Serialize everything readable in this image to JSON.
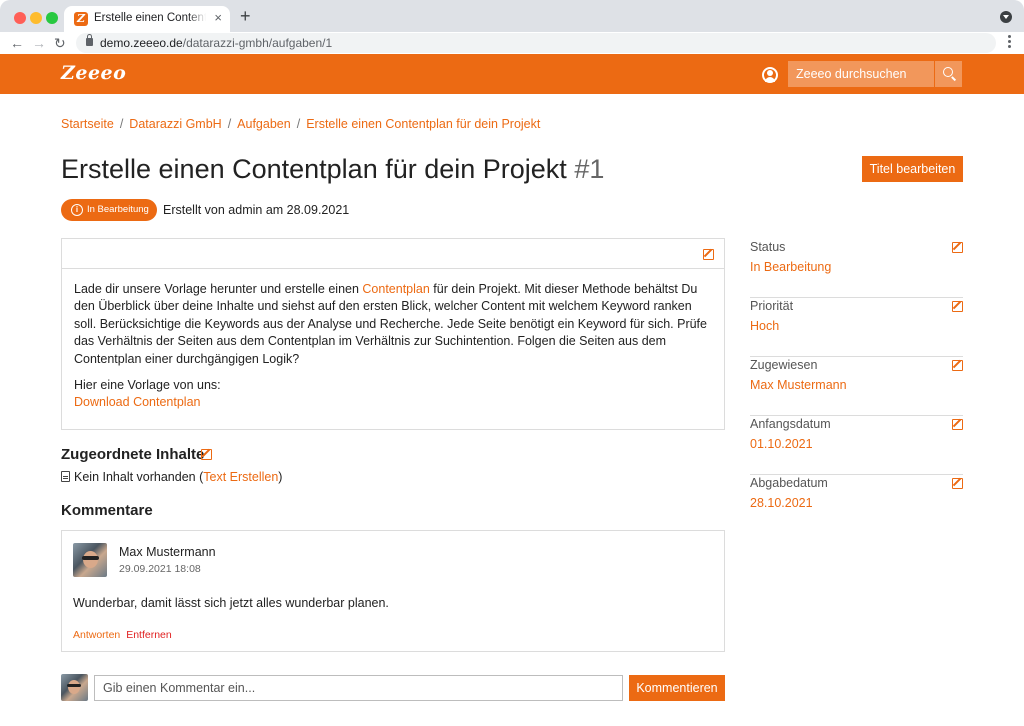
{
  "browser": {
    "tab_title": "Erstelle einen Contentplan für dein Projekt",
    "tab_close": "×",
    "new_tab": "+",
    "url_host": "demo.zeeeo.de",
    "url_path": "/datarazzi-gmbh/aufgaben/1",
    "nav_back": "←",
    "nav_forward": "→",
    "nav_reload": "↻",
    "favicon": "Z"
  },
  "header": {
    "logo": "Zeeeo",
    "search_placeholder": "Zeeeo durchsuchen"
  },
  "breadcrumb": {
    "items": [
      "Startseite",
      "Datarazzi GmbH",
      "Aufgaben",
      "Erstelle einen Contentplan für dein Projekt"
    ],
    "separator": "/"
  },
  "task": {
    "title": "Erstelle einen Contentplan für dein Projekt",
    "number": "#1",
    "edit_title_label": "Titel bearbeiten",
    "status_badge": "In Bearbeitung",
    "status_badge_icon": "i",
    "created_text": "Erstellt von admin am 28.09.2021"
  },
  "description": {
    "text_before": "Lade dir unsere Vorlage herunter und erstelle einen ",
    "link": "Contentplan",
    "text_after": " für dein Projekt. Mit dieser Methode behältst Du den Überblick über deine Inhalte und siehst auf den ersten Blick, welcher Content mit welchem Keyword ranken soll. Berücksichtige die Keywords aus der Analyse und Recherche. Jede Seite benötigt ein Keyword für sich. Prüfe das Verhältnis der Seiten aus dem Contentplan im Verhältnis zur Suchintention. Folgen die Seiten aus dem Contentplan einer durchgängigen Logik?",
    "template_intro": "Hier eine Vorlage von uns:",
    "download_link": "Download Contentplan"
  },
  "assigned": {
    "heading": "Zugeordnete Inhalte",
    "empty_text": "Kein Inhalt vorhanden (",
    "create_link": "Text Erstellen",
    "empty_close": ")"
  },
  "comments": {
    "heading": "Kommentare",
    "items": [
      {
        "author": "Max Mustermann",
        "date": "29.09.2021 18:08",
        "text": "Wunderbar, damit lässt sich jetzt alles wunderbar planen.",
        "reply_label": "Antworten",
        "remove_label": "Entfernen"
      }
    ],
    "input_placeholder": "Gib einen Kommentar ein...",
    "submit_label": "Kommentieren"
  },
  "sidebar": {
    "items": [
      {
        "label": "Status",
        "value": "In Bearbeitung"
      },
      {
        "label": "Priorität",
        "value": "Hoch"
      },
      {
        "label": "Zugewiesen",
        "value": "Max Mustermann"
      },
      {
        "label": "Anfangsdatum",
        "value": "01.10.2021"
      },
      {
        "label": "Abgabedatum",
        "value": "28.10.2021"
      }
    ]
  },
  "colors": {
    "accent": "#ec6a13",
    "danger": "#e02020"
  }
}
